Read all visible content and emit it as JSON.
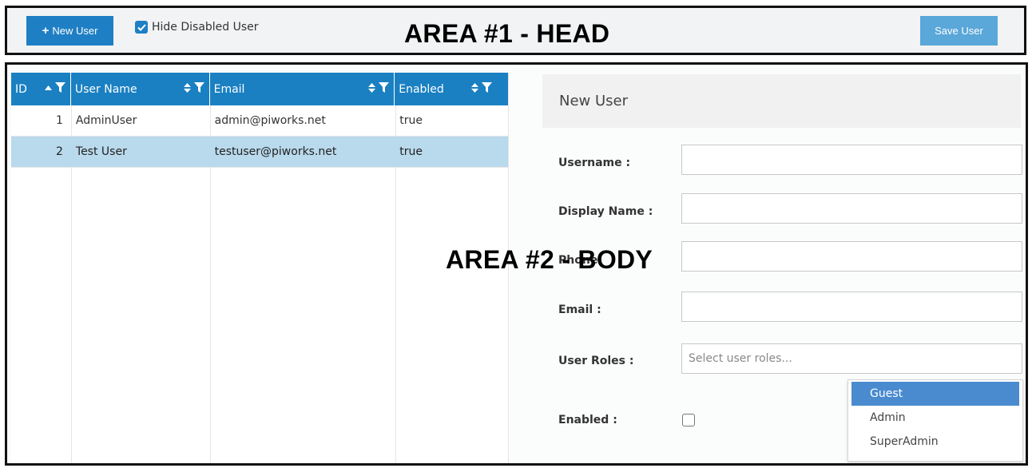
{
  "head": {
    "area_label": "AREA #1 - HEAD",
    "new_user_label": "New User",
    "hide_disabled_label": "Hide Disabled User",
    "hide_disabled_checked": true,
    "save_user_label": "Save User"
  },
  "body": {
    "area_label": "AREA #2 - BODY"
  },
  "grid": {
    "columns": [
      {
        "label": "ID"
      },
      {
        "label": "User Name"
      },
      {
        "label": "Email"
      },
      {
        "label": "Enabled"
      }
    ],
    "rows": [
      {
        "id": "1",
        "username": "AdminUser",
        "email": "admin@piworks.net",
        "enabled": "true",
        "selected": false
      },
      {
        "id": "2",
        "username": "Test User",
        "email": "testuser@piworks.net",
        "enabled": "true",
        "selected": true
      }
    ]
  },
  "form": {
    "title": "New User",
    "username_label": "Username :",
    "display_name_label": "Display Name :",
    "phone_label": "Phone",
    "email_label": "Email :",
    "user_roles_label": "User Roles :",
    "user_roles_placeholder": "Select user roles...",
    "enabled_label": "Enabled :",
    "enabled_checked": false,
    "roles_options": [
      "Guest",
      "Admin",
      "SuperAdmin"
    ],
    "roles_highlighted": "Guest"
  },
  "colors": {
    "primary": "#1f7fc4",
    "header_blue": "#1a80c2",
    "save_button": "#5aa7d9",
    "selected_row": "#b9d9ec",
    "dropdown_highlight": "#4a8bcf"
  }
}
